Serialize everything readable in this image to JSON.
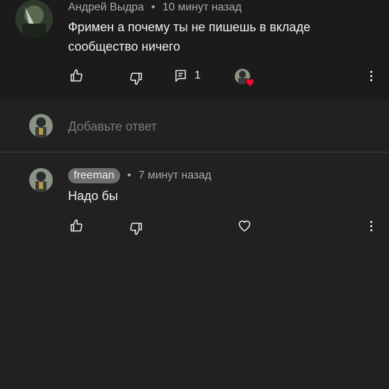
{
  "thread": {
    "top_comment": {
      "author": "Андрей Выдра",
      "separator": "•",
      "time": "10 минут назад",
      "text": "Фримен а почему ты не пишешь в вкладе сообщество ничего",
      "reply_count": "1",
      "icons": {
        "like": "thumb-up-icon",
        "dislike": "thumb-down-icon",
        "replies": "comment-icon",
        "creator_heart": "heart-badge-icon",
        "more": "more-vert-icon"
      }
    },
    "reply_input": {
      "placeholder": "Добавьте ответ"
    },
    "reply": {
      "author": "freeman",
      "separator": "•",
      "time": "7 минут назад",
      "text": "Надо бы",
      "icons": {
        "like": "thumb-up-icon",
        "dislike": "thumb-down-icon",
        "heart": "heart-outline-icon",
        "more": "more-vert-icon"
      }
    }
  },
  "colors": {
    "background": "#212121",
    "top_comment_bg": "#1b1b1b",
    "text": "#f1f1f1",
    "meta_text": "#aaaaaa",
    "placeholder": "#7a7a7a",
    "heart": "#ff0033",
    "author_badge": "#6e6e6e"
  }
}
